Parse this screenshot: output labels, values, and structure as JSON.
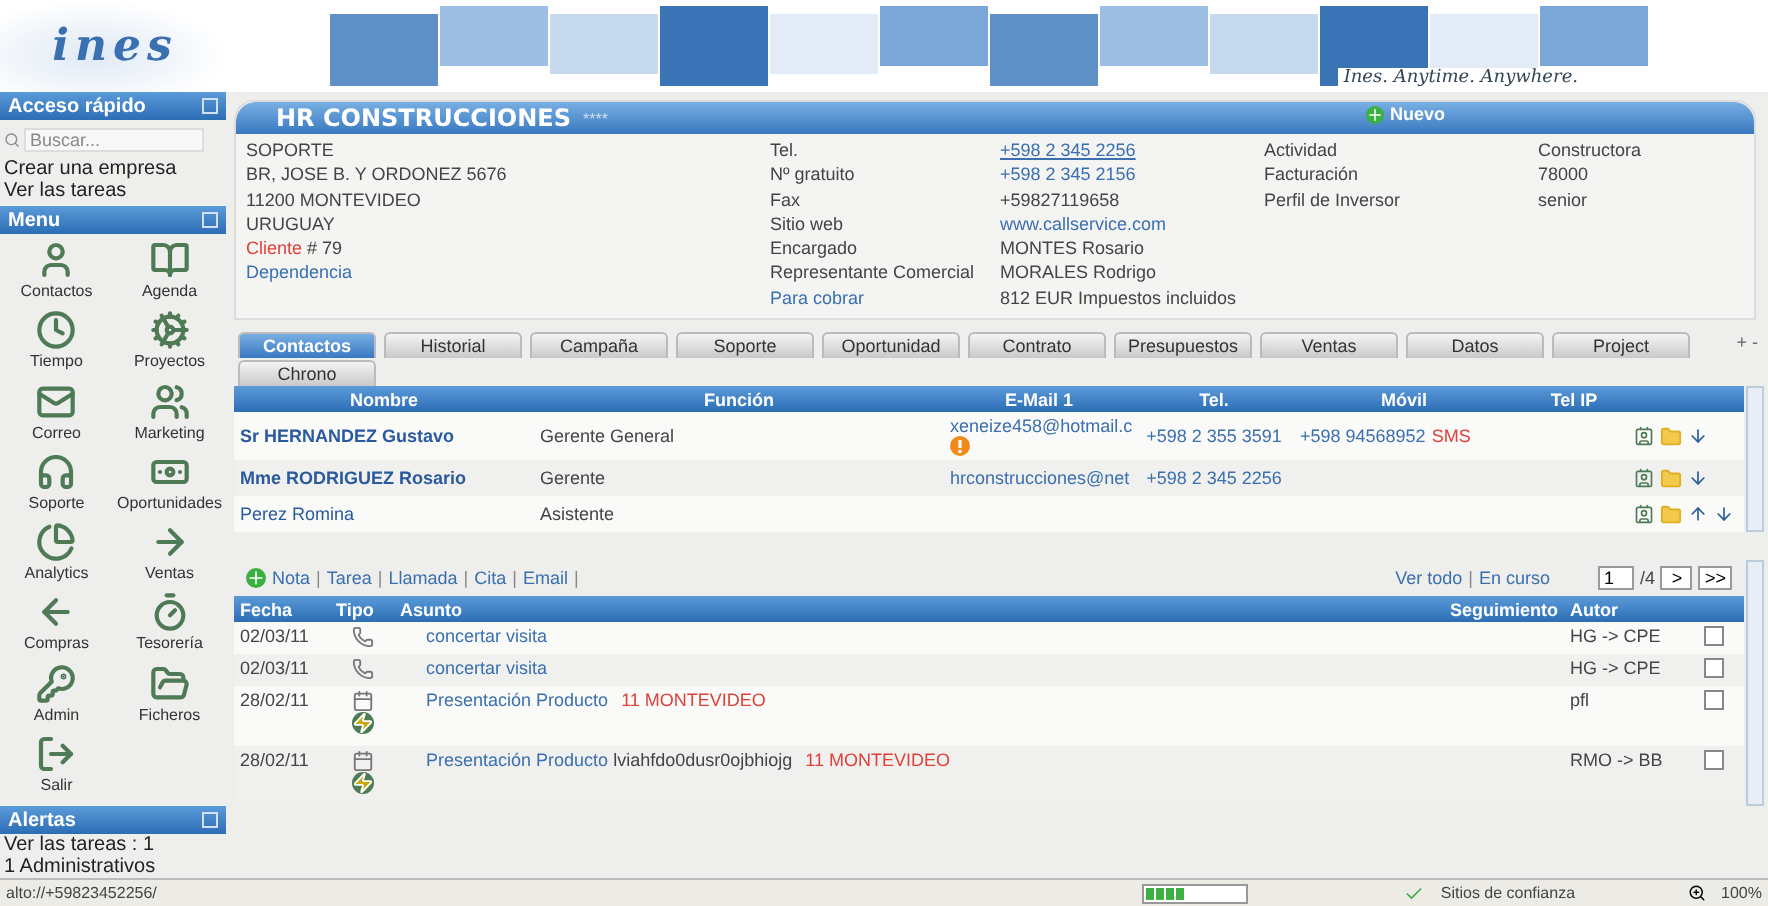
{
  "banner": {
    "logo": "ines",
    "tagline": "Ines. Anytime. Anywhere."
  },
  "sidebar": {
    "quick_access": {
      "title": "Acceso rápido",
      "search": {
        "placeholder": "Buscar..."
      },
      "links": [
        "Crear una empresa",
        "Ver las tareas"
      ]
    },
    "menu": {
      "title": "Menu",
      "items": [
        "Contactos",
        "Agenda",
        "Tiempo",
        "Proyectos",
        "Correo",
        "Marketing",
        "Soporte",
        "Oportunidades",
        "Analytics",
        "Ventas",
        "Compras",
        "Tesorería",
        "Admin",
        "Ficheros",
        "Salir"
      ]
    },
    "alerts": {
      "title": "Alertas",
      "lines": [
        "Ver las tareas : 1",
        "1 Administrativos"
      ]
    }
  },
  "company": {
    "name": "HR CONSTRUCCIONES",
    "stars": "****",
    "new_button": "Nuevo",
    "address": [
      "SOPORTE",
      "BR, JOSE B. Y ORDONEZ 5676",
      "11200 MONTEVIDEO",
      "URUGUAY"
    ],
    "client": {
      "label": "Cliente",
      "number": "# 79"
    },
    "dependency": "Dependencia",
    "fields": [
      {
        "label": "Tel.",
        "value": "+598 2 345 2256",
        "label_link": false,
        "value_link": true
      },
      {
        "label": "Nº gratuito",
        "value": "+598 2 345 2156",
        "label_link": false,
        "value_link": true
      },
      {
        "label": "Fax",
        "value": "+59827119658",
        "label_link": false,
        "value_link": false
      },
      {
        "label": "Sitio web",
        "value": "www.callservice.com",
        "label_link": false,
        "value_link": true
      },
      {
        "label": "Encargado",
        "value": "MONTES Rosario",
        "label_link": false,
        "value_link": false
      },
      {
        "label": "Representante Comercial",
        "value": "MORALES Rodrigo",
        "label_link": false,
        "value_link": false
      },
      {
        "label": "Para cobrar",
        "value": "812 EUR Impuestos incluidos",
        "label_link": true,
        "value_link": false
      }
    ],
    "extra": [
      {
        "label": "Actividad",
        "value": "Constructora"
      },
      {
        "label": "Facturación",
        "value": "78000"
      },
      {
        "label": "Perfil de Inversor",
        "value": "senior"
      }
    ]
  },
  "tabs": [
    {
      "label": "Contactos",
      "selected": true
    },
    {
      "label": "Historial",
      "selected": false
    },
    {
      "label": "Campaña",
      "selected": false
    },
    {
      "label": "Soporte",
      "selected": false
    },
    {
      "label": "Oportunidad",
      "selected": false
    },
    {
      "label": "Contrato",
      "selected": false
    },
    {
      "label": "Presupuestos",
      "selected": false
    },
    {
      "label": "Ventas",
      "selected": false
    },
    {
      "label": "Datos",
      "selected": false
    },
    {
      "label": "Project",
      "selected": false
    },
    {
      "label": "Chrono",
      "selected": false
    }
  ],
  "tabs_more": "+ -",
  "contacts": {
    "columns": [
      "Nombre",
      "Función",
      "E-Mail 1",
      "Tel.",
      "Móvil",
      "Tel IP"
    ],
    "rows": [
      {
        "name": "Sr HERNANDEZ Gustavo",
        "bold": true,
        "role": "Gerente General",
        "email": "xeneize458@hotmail.c",
        "warning": true,
        "tel": "+598 2 355 3591",
        "mobile": "+598 94568952",
        "sms": "SMS",
        "move_up": false
      },
      {
        "name": "Mme RODRIGUEZ Rosario",
        "bold": true,
        "role": "Gerente",
        "email": "hrconstrucciones@net",
        "warning": false,
        "tel": "+598 2 345 2256",
        "mobile": "",
        "sms": "",
        "move_up": false
      },
      {
        "name": "Perez Romina",
        "bold": false,
        "role": "Asistente",
        "email": "",
        "warning": false,
        "tel": "",
        "mobile": "",
        "sms": "",
        "move_up": true
      }
    ]
  },
  "activities": {
    "add_links": [
      "Nota",
      "Tarea",
      "Llamada",
      "Cita",
      "Email"
    ],
    "separator": "|",
    "filters": [
      "Ver todo",
      "En curso"
    ],
    "pager": {
      "page": "1",
      "total": "/4",
      "next": ">",
      "last": ">>"
    },
    "columns": [
      "Fecha",
      "Tipo",
      "Asunto",
      "Seguimiento",
      "Autor"
    ],
    "rows": [
      {
        "date": "02/03/11",
        "kind": "phone",
        "subject": "concertar visita",
        "detail": "",
        "place": "",
        "author": "HG -> CPE",
        "checked": false
      },
      {
        "date": "02/03/11",
        "kind": "phone",
        "subject": "concertar visita",
        "detail": "",
        "place": "",
        "author": "HG -> CPE",
        "checked": false
      },
      {
        "date": "28/02/11",
        "kind": "meeting",
        "subject": "Presentación Producto",
        "detail": "",
        "place": "11 MONTEVIDEO",
        "author": "pfl",
        "checked": false
      },
      {
        "date": "28/02/11",
        "kind": "meeting",
        "subject": "Presentación Producto",
        "detail": "lviahfdo0dusr0ojbhiojg",
        "place": "11 MONTEVIDEO",
        "author": "RMO -> BB",
        "checked": false
      }
    ]
  },
  "status_bar": {
    "url": "alto://+59823452256/",
    "level": 0.4,
    "zone": "Sitios de confianza",
    "zoom": "100%"
  }
}
